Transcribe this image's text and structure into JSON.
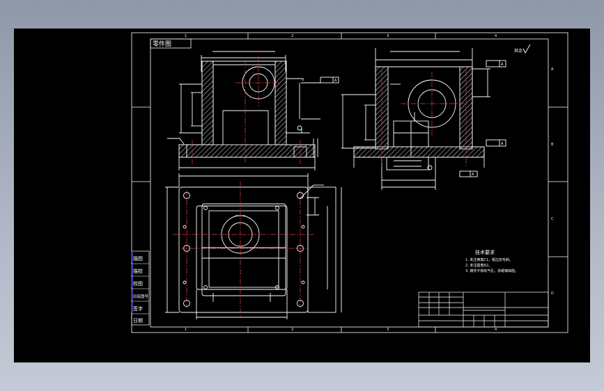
{
  "drawing": {
    "title": "零件图",
    "tech_req_title": "技术要求",
    "tech_req_items": [
      "1. 未注倒角C1，锐边去毛刺。",
      "2. 未注圆角R2。",
      "3. 铸件不得有气孔、砂眼等缺陷。"
    ],
    "roughness_note": "其余",
    "datum_label": "A",
    "border_numbers_top": [
      "1",
      "2",
      "3",
      "4"
    ],
    "border_numbers_bottom": [
      "1",
      "2",
      "3",
      "4"
    ],
    "border_letters_right": [
      "A",
      "B",
      "C",
      "D"
    ],
    "side_labels": [
      "描图",
      "描校",
      "校图",
      "旧底图号",
      "签字",
      "日期"
    ]
  },
  "colors": {
    "background": "#000000",
    "outline": "#ffffff",
    "hatch": "#ffffff",
    "centerline": "#e04040",
    "dimension": "#ffffff",
    "side_panel": "#3a3aa8"
  }
}
